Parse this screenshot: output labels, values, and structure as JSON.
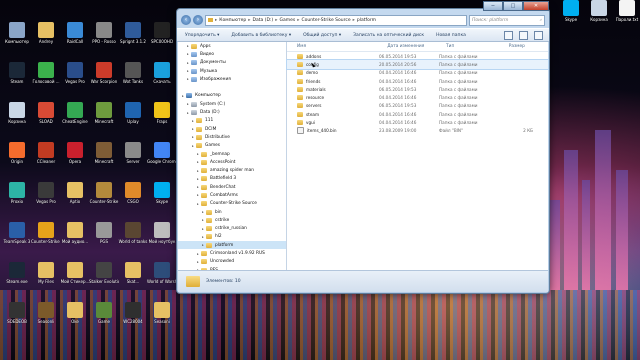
{
  "desktop": {
    "icons": [
      {
        "label": "Компьютер",
        "color": "#8aa5c8"
      },
      {
        "label": "Andrey",
        "color": "#e6c064"
      },
      {
        "label": "RaidCall",
        "color": "#3a8ad6"
      },
      {
        "label": "PPO - Rosso",
        "color": "#888888"
      },
      {
        "label": "Sprignt 3.1.2",
        "color": "#2f5b9a"
      },
      {
        "label": "SPC00OHD",
        "color": "#222222"
      },
      {
        "label": "Steam",
        "color": "#1b2838"
      },
      {
        "label": "Голосовой ...",
        "color": "#3bb14c"
      },
      {
        "label": "Vegas Pro",
        "color": "#2a4d8a"
      },
      {
        "label": "War Scorpion",
        "color": "#cc3b2a"
      },
      {
        "label": "Wot Tanks",
        "color": "#555555"
      },
      {
        "label": "Скачать",
        "color": "#1aa0dc"
      },
      {
        "label": "Корзина",
        "color": "#c9d6e6"
      },
      {
        "label": "SLOAD",
        "color": "#d84a35"
      },
      {
        "label": "CheatEngine",
        "color": "#34a853"
      },
      {
        "label": "Minecraft",
        "color": "#6e9b3e"
      },
      {
        "label": "Uplay",
        "color": "#1f64b0"
      },
      {
        "label": "Fraps",
        "color": "#f0c419"
      },
      {
        "label": "Origin",
        "color": "#f56c2d"
      },
      {
        "label": "CCleaner",
        "color": "#c23b22"
      },
      {
        "label": "Opera",
        "color": "#c9202d"
      },
      {
        "label": "Minecraft",
        "color": "#7e5c36"
      },
      {
        "label": "Server",
        "color": "#8a8a8a"
      },
      {
        "label": "Google Chrome",
        "color": "#4285f4"
      },
      {
        "label": "Proxio",
        "color": "#2db4a6"
      },
      {
        "label": "Vegas Pro",
        "color": "#3a3a3a"
      },
      {
        "label": "Aptio",
        "color": "#e6c064"
      },
      {
        "label": "Counter-Strike",
        "color": "#b48a3c"
      },
      {
        "label": "CSGO",
        "color": "#e08a2a"
      },
      {
        "label": "Skype",
        "color": "#00aff0"
      },
      {
        "label": "TeamSpeak 3",
        "color": "#2a5fa8"
      },
      {
        "label": "Counter-Strike Global",
        "color": "#e6a21a"
      },
      {
        "label": "Мой аудио...",
        "color": "#e6c064"
      },
      {
        "label": "PGS",
        "color": "#999999"
      },
      {
        "label": "World of tanks",
        "color": "#5a4632"
      },
      {
        "label": "Мой ноутбук",
        "color": "#bdbdbd"
      },
      {
        "label": "Steam.exe",
        "color": "#1b2838"
      },
      {
        "label": "My Files",
        "color": "#e6c064"
      },
      {
        "label": "Мой Стикер...",
        "color": "#e6c064"
      },
      {
        "label": "Stalker Evolutio...",
        "color": "#444444"
      },
      {
        "label": "Skat...",
        "color": "#e6c064"
      },
      {
        "label": "World of Warships",
        "color": "#2d4d7a"
      },
      {
        "label": "SOEDEOB",
        "color": "#333333"
      },
      {
        "label": "Seasonli",
        "color": "#7c5a2a"
      },
      {
        "label": "Oke",
        "color": "#e6c064"
      },
      {
        "label": "Game",
        "color": "#5a8a3a"
      },
      {
        "label": "WC28004",
        "color": "#2f2f2f"
      },
      {
        "label": "Seasoni",
        "color": "#e6c064"
      }
    ],
    "right_icons": [
      {
        "label": "Skype",
        "color": "#00aff0"
      },
      {
        "label": "Корзина",
        "color": "#c9d6e6"
      },
      {
        "label": "Пароли.txt",
        "color": "#f4f4f4"
      }
    ]
  },
  "window": {
    "controls": {
      "minimize": "−",
      "maximize": "□",
      "close": "✕"
    },
    "breadcrumb": [
      "Компьютер",
      "Data (D:)",
      "Games",
      "Counter-Strike Source",
      "platform"
    ],
    "search_placeholder": "Поиск: platform",
    "toolbar": [
      "Упорядочить ▾",
      "Добавить в библиотеку ▾",
      "Общий доступ ▾",
      "Записать на оптический диск",
      "Новая папка"
    ],
    "nav": [
      {
        "label": "Apps",
        "type": "folder",
        "indent": 1
      },
      {
        "label": "Видео",
        "type": "lib",
        "indent": 1
      },
      {
        "label": "Документы",
        "type": "lib",
        "indent": 1
      },
      {
        "label": "Музыка",
        "type": "lib",
        "indent": 1
      },
      {
        "label": "Изображения",
        "type": "lib",
        "indent": 1
      },
      {
        "label": "",
        "type": "none",
        "indent": 0
      },
      {
        "label": "Компьютер",
        "type": "pc",
        "indent": 0
      },
      {
        "label": "System (C:)",
        "type": "drive",
        "indent": 1
      },
      {
        "label": "Data (D:)",
        "type": "drive",
        "indent": 1
      },
      {
        "label": "111",
        "type": "folder",
        "indent": 2
      },
      {
        "label": "DCIM",
        "type": "folder",
        "indent": 2
      },
      {
        "label": "Distributive",
        "type": "folder",
        "indent": 2
      },
      {
        "label": "Games",
        "type": "folder",
        "indent": 2
      },
      {
        "label": "_bemnap",
        "type": "folder",
        "indent": 3
      },
      {
        "label": "AccessPoint",
        "type": "folder",
        "indent": 3
      },
      {
        "label": "amazing spider man",
        "type": "folder",
        "indent": 3
      },
      {
        "label": "Battlefield 3",
        "type": "folder",
        "indent": 3
      },
      {
        "label": "BenderChat",
        "type": "folder",
        "indent": 3
      },
      {
        "label": "CombatArms",
        "type": "folder",
        "indent": 3
      },
      {
        "label": "Counter-Strike Source",
        "type": "folder",
        "indent": 3
      },
      {
        "label": "bin",
        "type": "folder",
        "indent": 4
      },
      {
        "label": "cstrike",
        "type": "folder",
        "indent": 4
      },
      {
        "label": "cstrike_russian",
        "type": "folder",
        "indent": 4
      },
      {
        "label": "hl2",
        "type": "folder",
        "indent": 4
      },
      {
        "label": "platform",
        "type": "folder",
        "indent": 4
      },
      {
        "label": "Crimsonland v1.9.92 RUS",
        "type": "folder",
        "indent": 3
      },
      {
        "label": "Uncrowded",
        "type": "folder",
        "indent": 3
      },
      {
        "label": "PES ...",
        "type": "folder",
        "indent": 3
      }
    ],
    "columns": [
      "Имя",
      "Дата изменения",
      "Тип",
      "Размер"
    ],
    "files": [
      {
        "name": "addons",
        "date": "06.05.2014 19:53",
        "type": "Папка с файлами",
        "size": "",
        "icon": "folder"
      },
      {
        "name": "config",
        "date": "20.05.2014 20:56",
        "type": "Папка с файлами",
        "size": "",
        "icon": "folder"
      },
      {
        "name": "demo",
        "date": "04.04.2014 16:46",
        "type": "Папка с файлами",
        "size": "",
        "icon": "folder"
      },
      {
        "name": "friends",
        "date": "04.04.2014 16:46",
        "type": "Папка с файлами",
        "size": "",
        "icon": "folder"
      },
      {
        "name": "materials",
        "date": "06.05.2014 19:53",
        "type": "Папка с файлами",
        "size": "",
        "icon": "folder"
      },
      {
        "name": "resource",
        "date": "04.04.2014 16:46",
        "type": "Папка с файлами",
        "size": "",
        "icon": "folder"
      },
      {
        "name": "servers",
        "date": "06.05.2014 19:53",
        "type": "Папка с файлами",
        "size": "",
        "icon": "folder"
      },
      {
        "name": "steam",
        "date": "04.04.2014 16:46",
        "type": "Папка с файлами",
        "size": "",
        "icon": "folder"
      },
      {
        "name": "vgui",
        "date": "04.04.2014 16:46",
        "type": "Папка с файлами",
        "size": "",
        "icon": "folder"
      },
      {
        "name": "items_440.bin",
        "date": "23.08.2009 19:00",
        "type": "Файл \"BIN\"",
        "size": "2 КБ",
        "icon": "doc"
      }
    ],
    "hovered_file": 1,
    "status": "Элементов: 10"
  }
}
